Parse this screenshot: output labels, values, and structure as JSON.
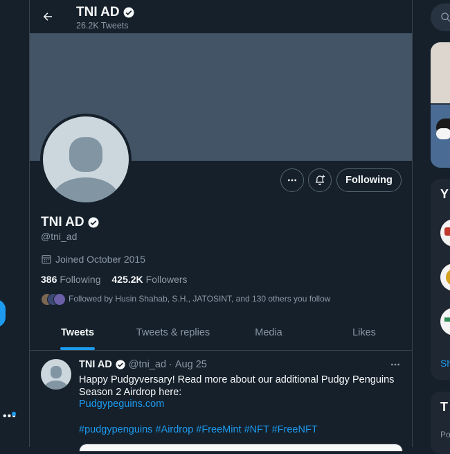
{
  "header": {
    "title": "TNI AD",
    "subtitle": "26.2K Tweets"
  },
  "profile": {
    "name": "TNI AD",
    "handle": "@tni_ad",
    "joined": "Joined October 2015",
    "following_count": "386",
    "following_label": "Following",
    "followers_count": "425.2K",
    "followers_label": "Followers",
    "followed_by": "Followed by Husin Shahab, S.H., JATOSINT, and 130 others you follow"
  },
  "actions": {
    "follow_label": "Following"
  },
  "tabs": [
    {
      "label": "Tweets",
      "active": true
    },
    {
      "label": "Tweets & replies",
      "active": false
    },
    {
      "label": "Media",
      "active": false
    },
    {
      "label": "Likes",
      "active": false
    }
  ],
  "tweet": {
    "name": "TNI AD",
    "handle": "@tni_ad",
    "date": "Aug 25",
    "text": "Happy Pudgyversary! Read more about our additional Pudgy Penguins Season 2 Airdrop here:",
    "link": "Pudgypeguins.com",
    "hashtags": "#pudgypenguins #Airdrop #FreeMint #NFT #FreeNFT"
  },
  "right_sidebar": {
    "panel2_heading_fragment": "Y",
    "panel2_link_fragment": "Sh",
    "panel3_heading_fragment": "T",
    "panel3_text_fragment": "Po"
  },
  "colors": {
    "background": "#15202b",
    "banner": "#425466",
    "accent": "#1d9bf0",
    "muted_text": "#8b98a5",
    "border": "#38444d"
  },
  "icons": [
    "back-arrow-icon",
    "verified-badge-icon",
    "more-options-icon",
    "notification-bell-plus-icon",
    "calendar-icon",
    "search-icon"
  ]
}
